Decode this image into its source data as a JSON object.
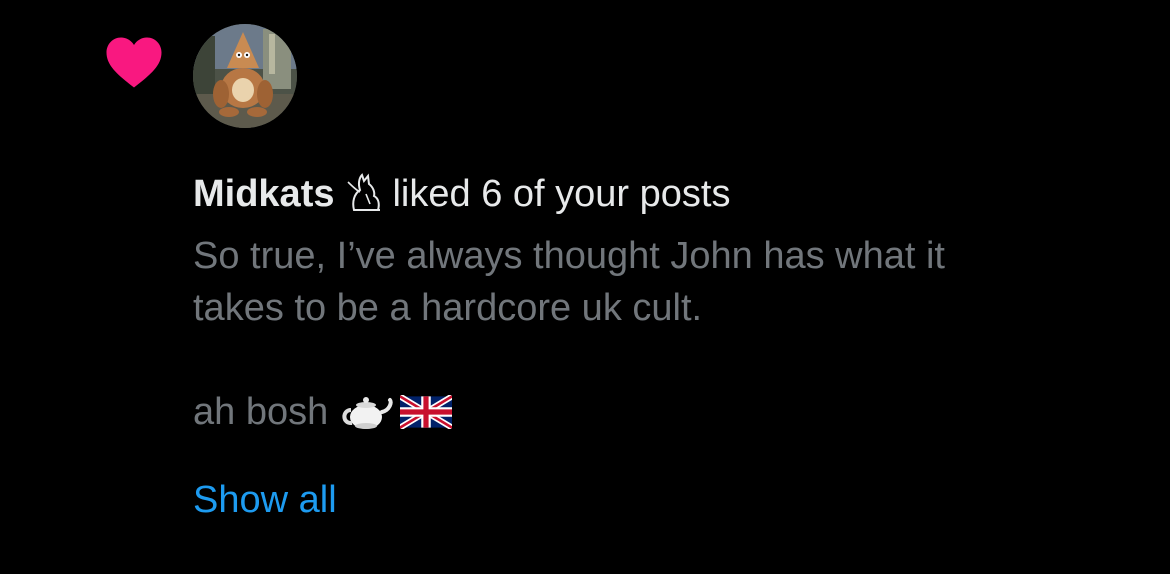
{
  "notification": {
    "type_icon": "heart-icon",
    "icon_color": "#f91880",
    "avatar": "avatar-image",
    "user_name": "Midkats",
    "name_emoji": "cat-emoji",
    "action_text": "liked 6 of your posts",
    "post_text": "So true, I’ve always thought John has what it\ntakes to be a hardcore uk cult.",
    "post_tail": "ah bosh",
    "tail_emojis": [
      "teapot-emoji",
      "uk-flag-emoji"
    ],
    "show_all_label": "Show all",
    "link_color": "#1d9bf0"
  }
}
